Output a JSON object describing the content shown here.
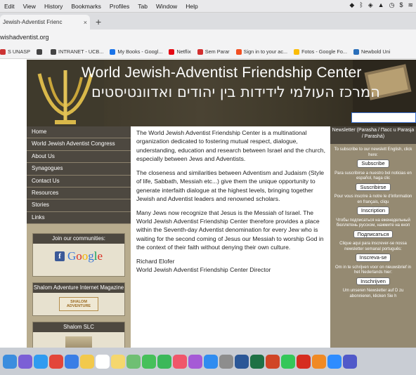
{
  "menubar": {
    "items": [
      "Edit",
      "View",
      "History",
      "Bookmarks",
      "Profiles",
      "Tab",
      "Window",
      "Help"
    ],
    "status_icons": [
      "dropbox-icon",
      "bluetooth-icon",
      "shield-icon",
      "drive-icon",
      "clock-icon",
      "dollar-icon",
      "wifi-icon"
    ]
  },
  "tab": {
    "title": "Jewish-Adventist Frienc",
    "close": "×",
    "new_tab": "+"
  },
  "address": {
    "url": "wishadventist.org"
  },
  "bookmarks": [
    {
      "label": "S UNASP",
      "color": "#c33"
    },
    {
      "label": "",
      "color": "#444"
    },
    {
      "label": "INTRANET - UCB...",
      "color": "#444"
    },
    {
      "label": "My Books - Googl...",
      "color": "#1a73e8"
    },
    {
      "label": "Netflix",
      "color": "#e50914"
    },
    {
      "label": "Sem Parar",
      "color": "#d32f2f"
    },
    {
      "label": "Sign in to your ac...",
      "color": "#f25022"
    },
    {
      "label": "Fotos - Google Fo...",
      "color": "#fbbc05"
    },
    {
      "label": "Newbold Uni",
      "color": "#2a6fba"
    }
  ],
  "banner": {
    "title_en": "World Jewish-Adventist Friendship Center",
    "title_he": "המרכז העולמי לידידות בין יהודים ואדוונטיסטים"
  },
  "nav": [
    "Home",
    "World Jewish Adventist Congress",
    "About Us",
    "Synagogues",
    "Contact Us",
    "Resources",
    "Stories",
    "Links"
  ],
  "sidebar_boxes": {
    "communities_title": "Join our communities:",
    "google_text": "Google",
    "magazine_title": "Shalom Adventure Internet Magazine",
    "magazine_logo": "SHALOM ADVENTURE",
    "slc_title": "Shalom SLC"
  },
  "main": {
    "p1": "The World Jewish Adventist Friendship Center is a multinational organization dedicated to fostering mutual respect, dialogue, understanding, education and research between Israel and the church, especially between Jews and Adventists.",
    "p2": "The closeness and similarities between Adventism and Judaism (Style of life, Sabbath, Messiah etc...) give them the unique opportunity to generate interfaith dialogue at the highest levels, bringing together Jewish and Adventist leaders and renowned scholars.",
    "p3": "Many Jews now recognize that Jesus is the Messiah of Israel. The World Jewish Adventist Friendship Center therefore provides a place within the Seventh-day Adventist denomination for every Jew who is waiting for the second coming of Jesus our Messiah to worship God in the context of their faith without denying their own culture.",
    "sig_name": "Richard Elofer",
    "sig_title": "World Jewish Adventist Friendship Center Director"
  },
  "newsletter": {
    "title": "Newsletter (Parasha / Пасс u Parasja / Parashá)",
    "blocks": [
      {
        "text": "To subscribe to our newslett English, click here:",
        "button": "Subscribe"
      },
      {
        "text": "Para suscribirse a nuestro bol noticias en español, haga clic",
        "button": "Suscribirse"
      },
      {
        "text": "Pour vous inscrire à notre le d'information en français, cliqu",
        "button": "Inscription"
      },
      {
        "text": "Чтобы подписаться на еженедельный бюллетень русском, нажмите на кноп",
        "button": "Подписаться"
      },
      {
        "text": "Clique aqui para inscrever-se nossa newsletter semanal português:",
        "button": "Inscreva-se"
      },
      {
        "text": "Om in te schrijven voor on nieuwsbrief in het Nederlands hier:",
        "button": "Inschrijven"
      },
      {
        "text": "Um unseren Newsletter auf D zu abonnieren, klicken Sie h",
        "button": ""
      }
    ]
  },
  "dock": {
    "icons": [
      "finder-icon",
      "siri-icon",
      "safari-icon",
      "chrome-icon",
      "mail-icon",
      "photos-icon",
      "calendar-icon",
      "notes-icon",
      "maps-icon",
      "messages-icon",
      "facetime-icon",
      "music-icon",
      "podcasts-icon",
      "appstore-icon",
      "preferences-icon",
      "word-icon",
      "excel-icon",
      "powerpoint-icon",
      "whatsapp-icon",
      "acrobat-icon",
      "vlc-icon",
      "zoom-icon",
      "teams-icon"
    ],
    "colors": [
      "#3b8dde",
      "#7b5fd6",
      "#2f9bf0",
      "#e3463a",
      "#3a7ee6",
      "#f2c94c",
      "#ffffff",
      "#f5d76e",
      "#6fbf73",
      "#46c05a",
      "#3bb85a",
      "#f0566a",
      "#a55ad6",
      "#2f8cf0",
      "#8d8d8d",
      "#2b5797",
      "#1e7145",
      "#d04526",
      "#34c759",
      "#d62d20",
      "#f08a24",
      "#2d8cff",
      "#5059c9"
    ]
  }
}
